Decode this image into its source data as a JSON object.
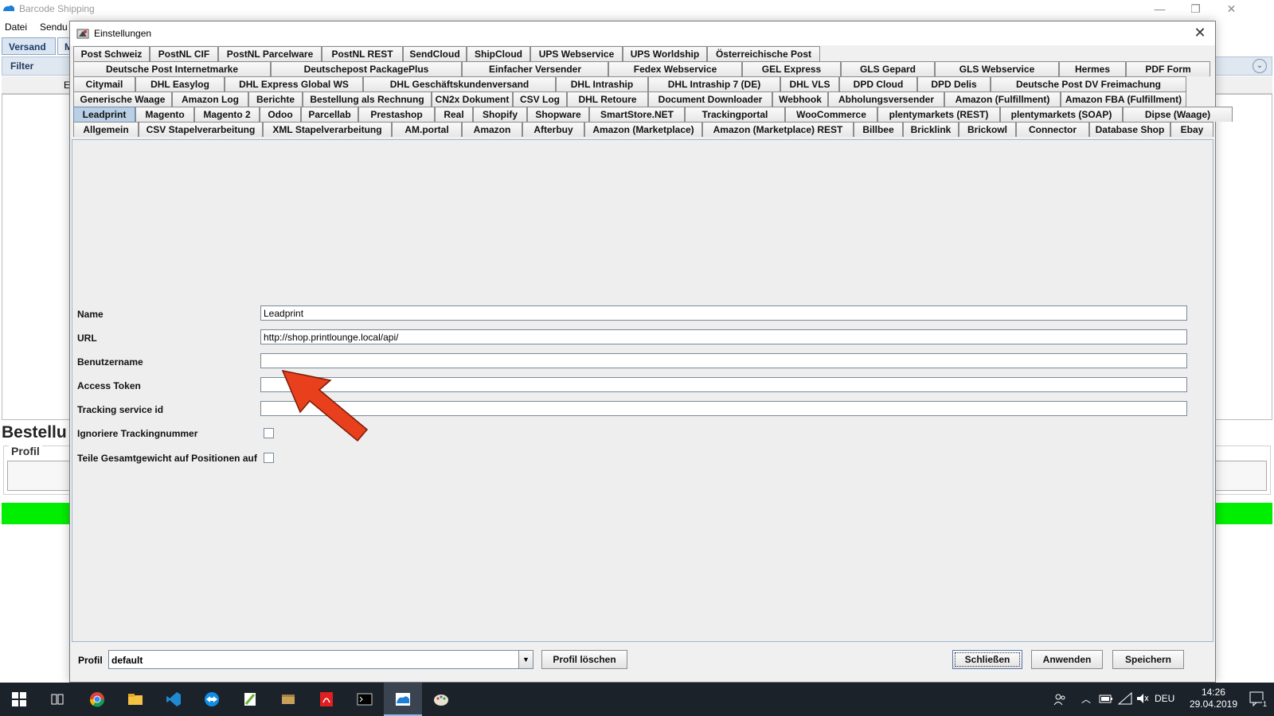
{
  "main_window": {
    "title": "Barcode Shipping",
    "controls": {
      "minimize": "—",
      "restore": "❐",
      "close": "✕"
    },
    "menu": [
      "Datei",
      "Sendu"
    ],
    "tabs": [
      "Versand",
      "M"
    ],
    "filter_label": "Filter",
    "grid_header_fragment": "E",
    "heading_fragment": "Bestellu",
    "profil_group_label": "Profil",
    "collapse_glyph": "⌄"
  },
  "dialog": {
    "title": "Einstellungen",
    "close_glyph": "✕",
    "tab_rows": [
      [
        "Post Schweiz",
        "PostNL CIF",
        "PostNL Parcelware",
        "PostNL REST",
        "SendCloud",
        "ShipCloud",
        "UPS Webservice",
        "UPS Worldship",
        "Österreichische Post"
      ],
      [
        "Deutsche Post Internetmarke",
        "Deutschepost PackagePlus",
        "Einfacher Versender",
        "Fedex Webservice",
        "GEL Express",
        "GLS Gepard",
        "GLS Webservice",
        "Hermes",
        "PDF Form"
      ],
      [
        "Citymail",
        "DHL Easylog",
        "DHL Express Global WS",
        "DHL Geschäftskundenversand",
        "DHL Intraship",
        "DHL Intraship 7 (DE)",
        "DHL VLS",
        "DPD Cloud",
        "DPD Delis",
        "Deutsche Post DV Freimachung"
      ],
      [
        "Generische Waage",
        "Amazon Log",
        "Berichte",
        "Bestellung als Rechnung",
        "CN2x Dokument",
        "CSV Log",
        "DHL Retoure",
        "Document Downloader",
        "Webhook",
        "Abholungsversender",
        "Amazon (Fulfillment)",
        "Amazon FBA (Fulfillment)"
      ],
      [
        "Leadprint",
        "Magento",
        "Magento 2",
        "Odoo",
        "Parcellab",
        "Prestashop",
        "Real",
        "Shopify",
        "Shopware",
        "SmartStore.NET",
        "Trackingportal",
        "WooCommerce",
        "plentymarkets (REST)",
        "plentymarkets (SOAP)",
        "Dipse (Waage)"
      ],
      [
        "Allgemein",
        "CSV Stapelverarbeitung",
        "XML Stapelverarbeitung",
        "AM.portal",
        "Amazon",
        "Afterbuy",
        "Amazon (Marketplace)",
        "Amazon (Marketplace) REST",
        "Billbee",
        "Bricklink",
        "Brickowl",
        "Connector",
        "Database Shop",
        "Ebay"
      ]
    ],
    "selected_tab": "Leadprint",
    "form": {
      "name_label": "Name",
      "name_value": "Leadprint",
      "url_label": "URL",
      "url_value": "http://shop.printlounge.local/api/",
      "username_label": "Benutzername",
      "username_value": "",
      "token_label": "Access Token",
      "token_value": "",
      "tracking_id_label": "Tracking service id",
      "tracking_id_value": "",
      "ignore_tracking_label": "Ignoriere Trackingnummer",
      "ignore_tracking_checked": false,
      "split_weight_label": "Teile Gesamtgewicht auf Positionen auf",
      "split_weight_checked": false
    },
    "annotation_arrow_color": "#e8401c",
    "bottom": {
      "profil_label": "Profil",
      "profil_value": "default",
      "delete_button": "Profil löschen",
      "close_button": "Schließen",
      "apply_button": "Anwenden",
      "save_button": "Speichern"
    }
  },
  "taskbar": {
    "apps": [
      "start",
      "task-view",
      "chrome",
      "file-explorer",
      "vscode",
      "teamviewer",
      "notepad-plus",
      "package",
      "acrobat",
      "terminal",
      "barcode-shipping",
      "paint"
    ],
    "active_app": "barcode-shipping",
    "language": "DEU",
    "time": "14:26",
    "date": "29.04.2019",
    "notification_count": "1"
  }
}
